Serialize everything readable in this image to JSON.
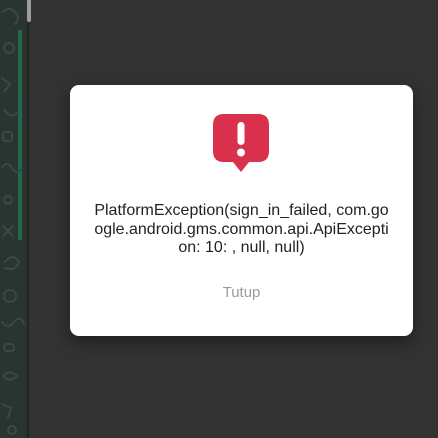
{
  "colors": {
    "overlay": "#333333",
    "background_panel": "#2a3430",
    "accent": "#1f6b4a",
    "dialog_background": "#ffffff",
    "alert_icon": "#d9304b",
    "message_text": "#222222",
    "button_text": "#9a9a9a"
  },
  "dialog": {
    "icon": "alert-bubble-icon",
    "message": "PlatformException(sign_in_failed, com.google.android.gms.common.api.ApiException: 10: , null, null)",
    "close_label": "Tutup"
  }
}
